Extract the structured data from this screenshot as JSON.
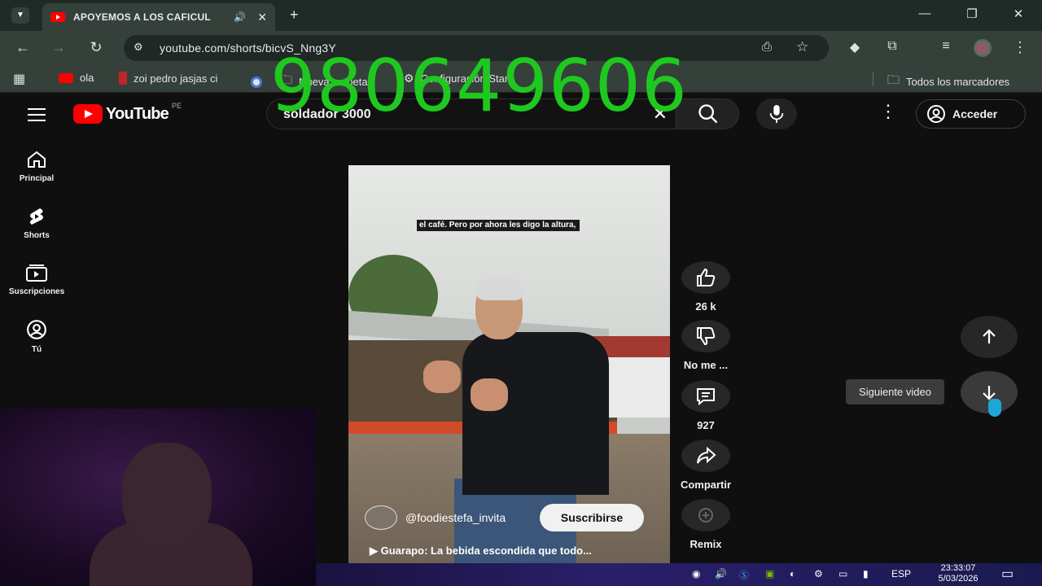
{
  "browser": {
    "tab_title": "APOYEMOS A LOS CAFICUL",
    "url": "youtube.com/shorts/bicvS_Nng3Y",
    "bookmarks": [
      {
        "label": "ola"
      },
      {
        "label": "zoi pedro jasjas ci"
      },
      {
        "label": "Nueva carpeta"
      },
      {
        "label": "Configuración Starc"
      }
    ],
    "all_bookmarks_label": "Todos los marcadores"
  },
  "overlay": {
    "phone_number": "980649606"
  },
  "youtube": {
    "logo_word": "YouTube",
    "country_code": "PE",
    "search_value": "soldador 3000",
    "sign_in_label": "Acceder",
    "sidebar": [
      {
        "label": "Principal"
      },
      {
        "label": "Shorts"
      },
      {
        "label": "Suscripciones"
      },
      {
        "label": "Tú"
      }
    ]
  },
  "short": {
    "caption": "el café. Pero por ahora les digo la altura,",
    "channel_handle": "@foodiestefa_invita",
    "subscribe_label": "Suscribirse",
    "title": "▶  Guarapo: La bebida escondida que todo...",
    "actions": {
      "like_count": "26 k",
      "dislike_label": "No me ...",
      "comment_count": "927",
      "share_label": "Compartir",
      "remix_label": "Remix"
    },
    "next_tooltip": "Siguiente video"
  },
  "taskbar": {
    "language": "ESP",
    "time": "23:33:07",
    "date": "5/03/2026"
  },
  "colors": {
    "youtube_red": "#ff0000",
    "phone_overlay": "#1fc81f",
    "page_bg": "#0f0f0f"
  }
}
